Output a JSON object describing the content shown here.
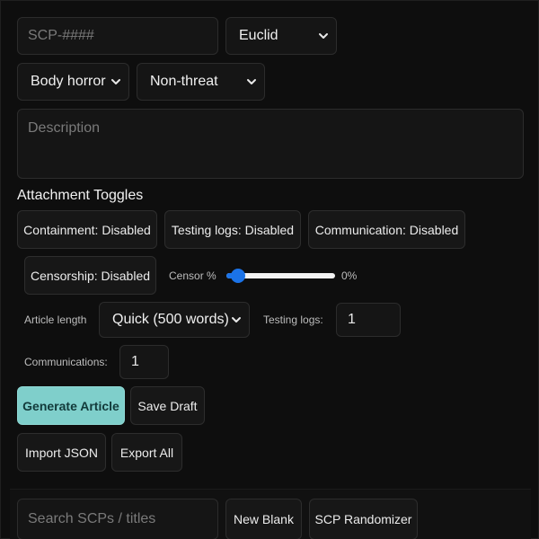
{
  "form": {
    "scp_id_placeholder": "SCP-####",
    "object_class": "Euclid",
    "tone": "Body horror",
    "threat": "Non-threat",
    "description_placeholder": "Description"
  },
  "attachments": {
    "title": "Attachment Toggles",
    "containment": "Containment: Disabled",
    "testing_logs": "Testing logs: Disabled",
    "communication": "Communication: Disabled",
    "censorship": "Censorship: Disabled",
    "censor_label": "Censor %",
    "censor_value": "0%",
    "censor_fraction": 0.0
  },
  "options": {
    "article_length_label": "Article length",
    "article_length": "Quick (500 words)",
    "testing_logs_label": "Testing logs:",
    "testing_logs_count": "1",
    "communications_label": "Communications:",
    "communications_count": "1"
  },
  "actions": {
    "generate": "Generate Article",
    "save_draft": "Save Draft",
    "import_json": "Import JSON",
    "export_all": "Export All"
  },
  "library": {
    "search_placeholder": "Search SCPs / titles",
    "new_blank": "New Blank",
    "randomizer": "SCP Randomizer"
  },
  "colors": {
    "background": "#0e0e0e",
    "primary_button": "#7fcfcb",
    "slider_accent": "#1b73e8"
  }
}
